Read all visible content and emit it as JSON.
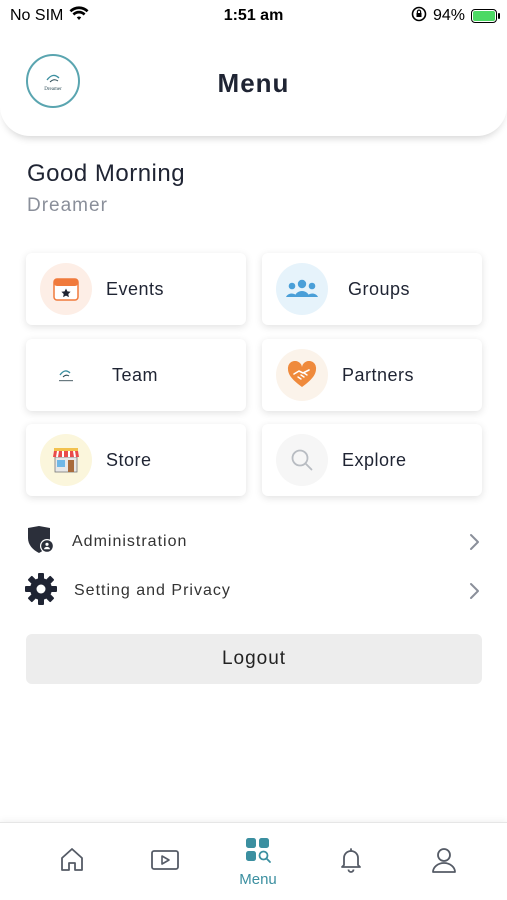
{
  "status_bar": {
    "carrier": "No SIM",
    "time": "1:51 am",
    "battery_percent": "94%",
    "icons": [
      "wifi-icon",
      "orientation-lock-icon",
      "battery-charging-icon"
    ]
  },
  "header": {
    "title": "Menu",
    "logo_text": "Dreamer"
  },
  "greeting": {
    "salutation": "Good Morning",
    "name": "Dreamer"
  },
  "cards": [
    {
      "label": "Events",
      "icon": "calendar-star-icon"
    },
    {
      "label": "Groups",
      "icon": "people-group-icon"
    },
    {
      "label": "Team",
      "icon": "team-logo-icon"
    },
    {
      "label": "Partners",
      "icon": "heart-handshake-icon"
    },
    {
      "label": "Store",
      "icon": "storefront-icon"
    },
    {
      "label": "Explore",
      "icon": "search-icon"
    }
  ],
  "list": [
    {
      "label": "Administration",
      "icon": "shield-user-icon"
    },
    {
      "label": "Setting and Privacy",
      "icon": "gear-icon"
    }
  ],
  "logout_label": "Logout",
  "tabbar": {
    "active": "Menu",
    "items": [
      {
        "name": "home",
        "icon": "home-icon"
      },
      {
        "name": "video",
        "icon": "video-icon"
      },
      {
        "name": "menu",
        "label": "Menu",
        "icon": "menu-grid-icon"
      },
      {
        "name": "notifications",
        "icon": "bell-icon"
      },
      {
        "name": "profile",
        "icon": "user-icon"
      }
    ]
  },
  "colors": {
    "accent": "#3b8fa0",
    "text_primary": "#1f2433",
    "text_secondary": "#8a8f9a"
  }
}
